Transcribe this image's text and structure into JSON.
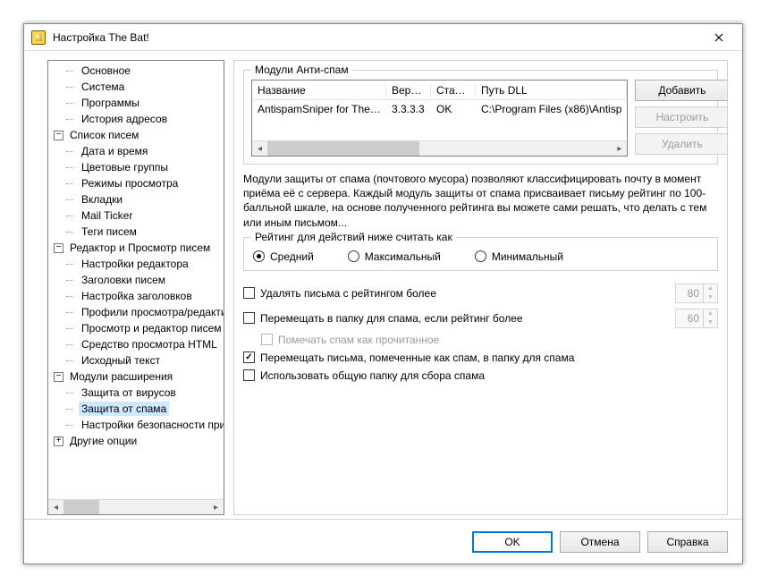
{
  "window": {
    "title": "Настройка The Bat!"
  },
  "tree": [
    {
      "depth": 1,
      "expander": null,
      "label": "Основное"
    },
    {
      "depth": 1,
      "expander": null,
      "label": "Система"
    },
    {
      "depth": 1,
      "expander": null,
      "label": "Программы"
    },
    {
      "depth": 1,
      "expander": null,
      "label": "История адресов"
    },
    {
      "depth": 0,
      "expander": "−",
      "label": "Список писем"
    },
    {
      "depth": 1,
      "expander": null,
      "label": "Дата и время"
    },
    {
      "depth": 1,
      "expander": null,
      "label": "Цветовые группы"
    },
    {
      "depth": 1,
      "expander": null,
      "label": "Режимы просмотра"
    },
    {
      "depth": 1,
      "expander": null,
      "label": "Вкладки"
    },
    {
      "depth": 1,
      "expander": null,
      "label": "Mail Ticker"
    },
    {
      "depth": 1,
      "expander": null,
      "label": "Теги писем"
    },
    {
      "depth": 0,
      "expander": "−",
      "label": "Редактор и Просмотр писем"
    },
    {
      "depth": 1,
      "expander": null,
      "label": "Настройки редактора"
    },
    {
      "depth": 1,
      "expander": null,
      "label": "Заголовки писем"
    },
    {
      "depth": 1,
      "expander": null,
      "label": "Настройка заголовков"
    },
    {
      "depth": 1,
      "expander": null,
      "label": "Профили просмотра/редактирования"
    },
    {
      "depth": 1,
      "expander": null,
      "label": "Просмотр и редактор писем"
    },
    {
      "depth": 1,
      "expander": null,
      "label": "Средство просмотра HTML"
    },
    {
      "depth": 1,
      "expander": null,
      "label": "Исходный текст"
    },
    {
      "depth": 0,
      "expander": "−",
      "label": "Модули расширения"
    },
    {
      "depth": 1,
      "expander": null,
      "label": "Защита от вирусов"
    },
    {
      "depth": 1,
      "expander": null,
      "label": "Защита от спама",
      "selected": true
    },
    {
      "depth": 1,
      "expander": null,
      "label": "Настройки безопасности приложения"
    },
    {
      "depth": 0,
      "expander": "+",
      "label": "Другие опции"
    }
  ],
  "modules_group_title": "Модули Анти-спам",
  "modules_headers": {
    "name": "Название",
    "version": "Верс...",
    "status": "Статус",
    "dll": "Путь DLL"
  },
  "modules_rows": [
    {
      "name": "AntispamSniper for The ...",
      "version": "3.3.3.3",
      "status": "OK",
      "dll": "C:\\Program Files (x86)\\Antisp"
    }
  ],
  "buttons": {
    "add": "Добавить",
    "config": "Настроить",
    "del": "Удалить"
  },
  "description": "Модули защиты от спама (почтового мусора) позволяют классифицировать почту в момент приёма её с сервера. Каждый модуль защиты от спама присваивает письму рейтинг по 100-балльной шкале, на основе полученного рейтинга вы можете сами решать, что делать с тем или иным письмом...",
  "rating_group_title": "Рейтинг для действий ниже считать как",
  "rating_options": {
    "mid": "Средний",
    "max": "Максимальный",
    "min": "Минимальный"
  },
  "opts": {
    "delete_label": "Удалять письма с рейтингом более",
    "delete_value": "80",
    "move_label": "Перемещать в папку для спама, если рейтинг более",
    "move_value": "60",
    "mark_read_label": "Помечать спам как прочитанное",
    "move_marked_label": "Перемещать письма, помеченные как спам, в папку для спама",
    "common_folder_label": "Использовать общую папку для сбора спама"
  },
  "footer": {
    "ok": "OK",
    "cancel": "Отмена",
    "help": "Справка"
  }
}
